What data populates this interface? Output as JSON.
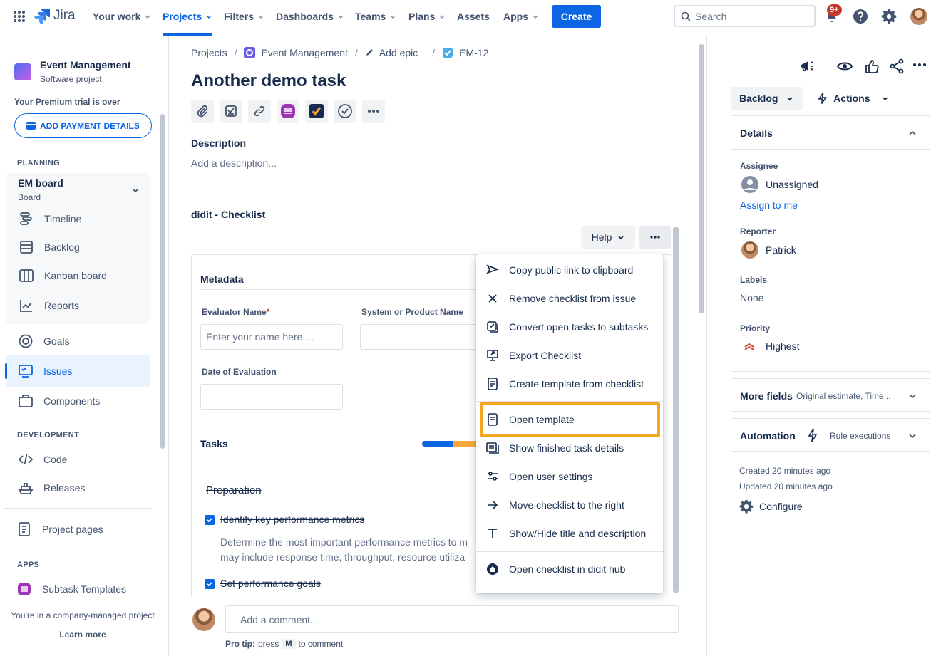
{
  "topbar": {
    "brand": "Jira",
    "nav": [
      "Your work",
      "Projects",
      "Filters",
      "Dashboards",
      "Teams",
      "Plans",
      "Assets",
      "Apps"
    ],
    "create_label": "Create",
    "search_placeholder": "Search",
    "notifications_badge": "9+"
  },
  "sidebar": {
    "project_name": "Event Management",
    "project_type": "Software project",
    "trial_text": "Your Premium trial is over",
    "payment_button": "ADD PAYMENT DETAILS",
    "planning_header": "PLANNING",
    "board_name": "EM board",
    "board_type": "Board",
    "planning_items": [
      "Timeline",
      "Backlog",
      "Kanban board",
      "Reports"
    ],
    "goals": "Goals",
    "issues": "Issues",
    "components": "Components",
    "development_header": "DEVELOPMENT",
    "code": "Code",
    "releases": "Releases",
    "project_pages": "Project pages",
    "apps_header": "APPS",
    "subtask_templates": "Subtask Templates",
    "footer_text": "You're in a company-managed project",
    "learn_more": "Learn more"
  },
  "issue": {
    "breadcrumbs": [
      "Projects",
      "Event Management",
      "Add epic",
      "EM-12"
    ],
    "title": "Another demo task",
    "description_label": "Description",
    "description_placeholder": "Add a description...",
    "checklist_title": "didit - Checklist",
    "help_label": "Help",
    "metadata_title": "Metadata",
    "evaluator_label": "Evaluator Name",
    "required_mark": "*",
    "evaluator_placeholder": "Enter your name here ...",
    "system_label": "System or Product Name",
    "date_label": "Date of Evaluation",
    "tasks_title": "Tasks",
    "task_progress": 0.55,
    "section_preparation": "Preparation",
    "task1": "Identify key performance metrics",
    "task1_desc": "Determine the most important performance metrics to m may include response time, throughput, resource utiliza",
    "task2": "Set performance goals",
    "comment_placeholder": "Add a comment...",
    "protip_prefix": "Pro tip:",
    "protip_mid": "press",
    "protip_key": "M",
    "protip_suffix": "to comment"
  },
  "menu": {
    "items": [
      "Copy public link to clipboard",
      "Remove checklist from issue",
      "Convert open tasks to subtasks",
      "Export Checklist",
      "Create template from checklist",
      "Open template",
      "Show finished task details",
      "Open user settings",
      "Move checklist to the right",
      "Show/Hide title and description",
      "Open checklist in didit hub"
    ]
  },
  "details": {
    "status": "Backlog",
    "actions": "Actions",
    "panel_title": "Details",
    "assignee_label": "Assignee",
    "assignee_value": "Unassigned",
    "assign_to_me": "Assign to me",
    "reporter_label": "Reporter",
    "reporter_value": "Patrick",
    "labels_label": "Labels",
    "labels_value": "None",
    "priority_label": "Priority",
    "priority_value": "Highest",
    "more_fields": "More fields",
    "more_fields_hint": "Original estimate, Time...",
    "automation": "Automation",
    "rule_executions": "Rule executions",
    "created": "Created 20 minutes ago",
    "updated": "Updated 20 minutes ago",
    "configure": "Configure"
  },
  "colors": {
    "brand_blue": "#0c66e4",
    "highlight_orange": "#f5a623",
    "priority_red": "#e2483d"
  }
}
